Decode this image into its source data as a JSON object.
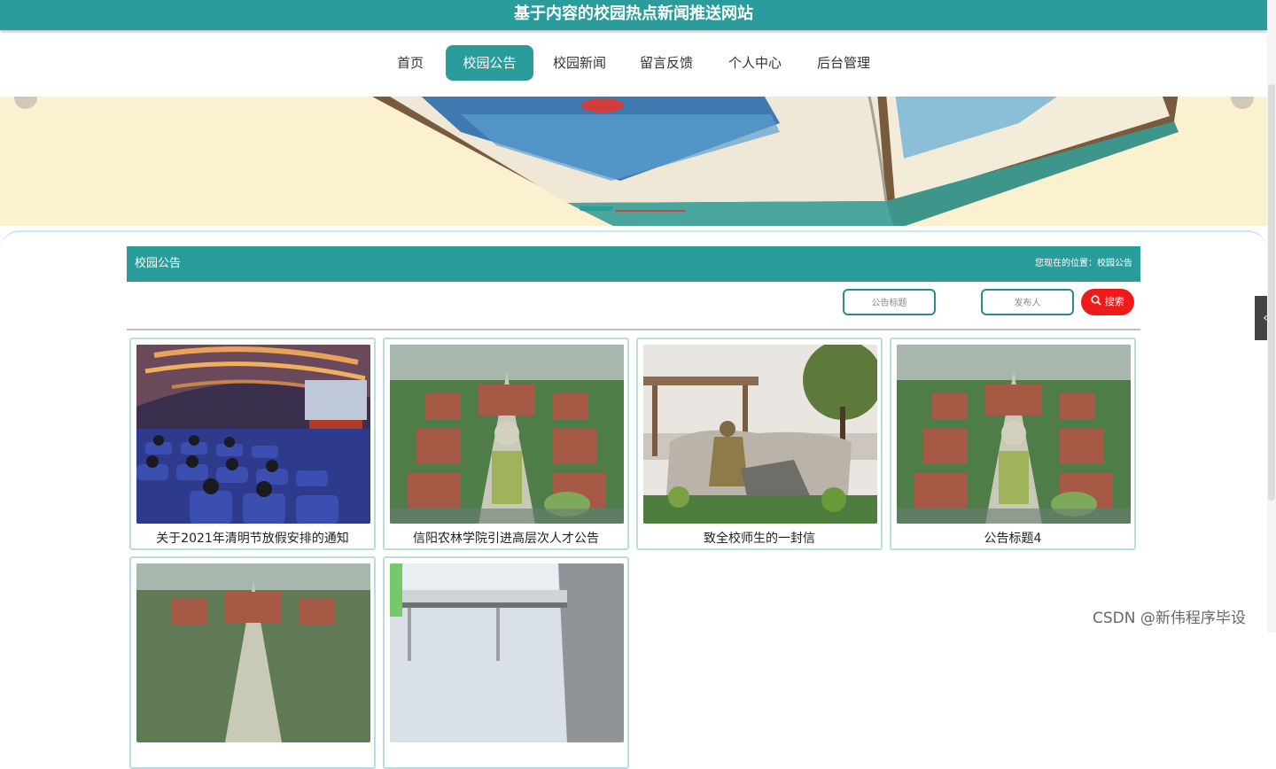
{
  "header": {
    "site_title": "基于内容的校园热点新闻推送网站"
  },
  "nav": {
    "items": [
      {
        "label": "首页"
      },
      {
        "label": "校园公告"
      },
      {
        "label": "校园新闻"
      },
      {
        "label": "留言反馈"
      },
      {
        "label": "个人中心"
      },
      {
        "label": "后台管理"
      }
    ],
    "active_index": 1
  },
  "section": {
    "title": "校园公告",
    "location": "您现在的位置：校园公告"
  },
  "search": {
    "title_placeholder": "公告标题",
    "publisher_placeholder": "发布人",
    "button_label": "搜索"
  },
  "cards": [
    {
      "caption": "关于2021年清明节放假安排的通知",
      "image": "auditorium-photo"
    },
    {
      "caption": "信阳农林学院引进高层次人才公告",
      "image": "campus-aerial-photo"
    },
    {
      "caption": "致全校师生的一封信",
      "image": "statue-photo"
    },
    {
      "caption": "公告标题4",
      "image": "campus-aerial-photo"
    },
    {
      "caption": "",
      "image": "campus-aerial-photo"
    },
    {
      "caption": "",
      "image": "building-photo"
    }
  ],
  "watermark": "CSDN @新伟程序毕设",
  "colors": {
    "accent": "#2a9c9c",
    "search_button": "#ee1b1b"
  }
}
